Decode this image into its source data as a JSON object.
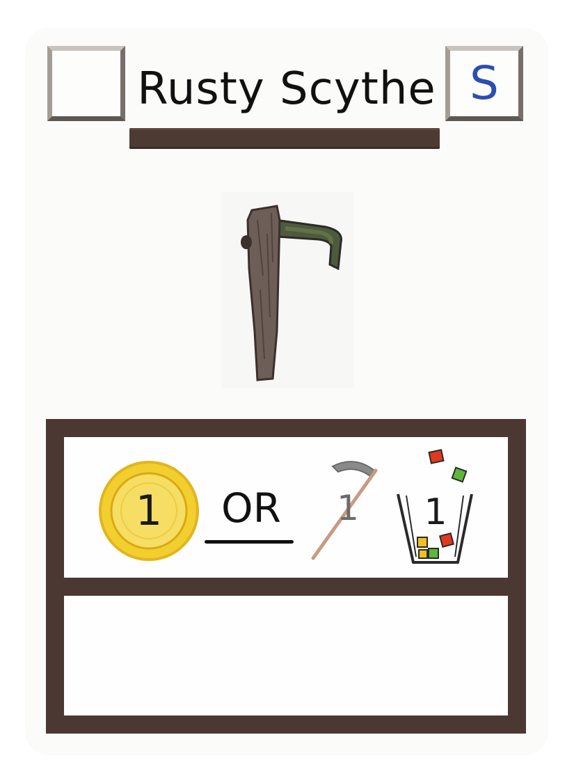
{
  "card": {
    "title": "Rusty Scythe",
    "type_letter": "S",
    "type_letter_color": "#2a4fb0",
    "frame_color": "#4b3832",
    "art_icon": "rusty-scythe-icon"
  },
  "cost": {
    "coin_value": "1",
    "coin_icon": "gold-coin-icon",
    "or_label": "OR",
    "scythe_value": "1",
    "scythe_icon": "scythe-icon",
    "bucket_value": "1",
    "bucket_icon": "bucket-icon",
    "coin_color": "#f2cf2e",
    "bucket_gem_colors": [
      "#e03a1e",
      "#5cb83a",
      "#f0c020"
    ]
  },
  "text_box": ""
}
